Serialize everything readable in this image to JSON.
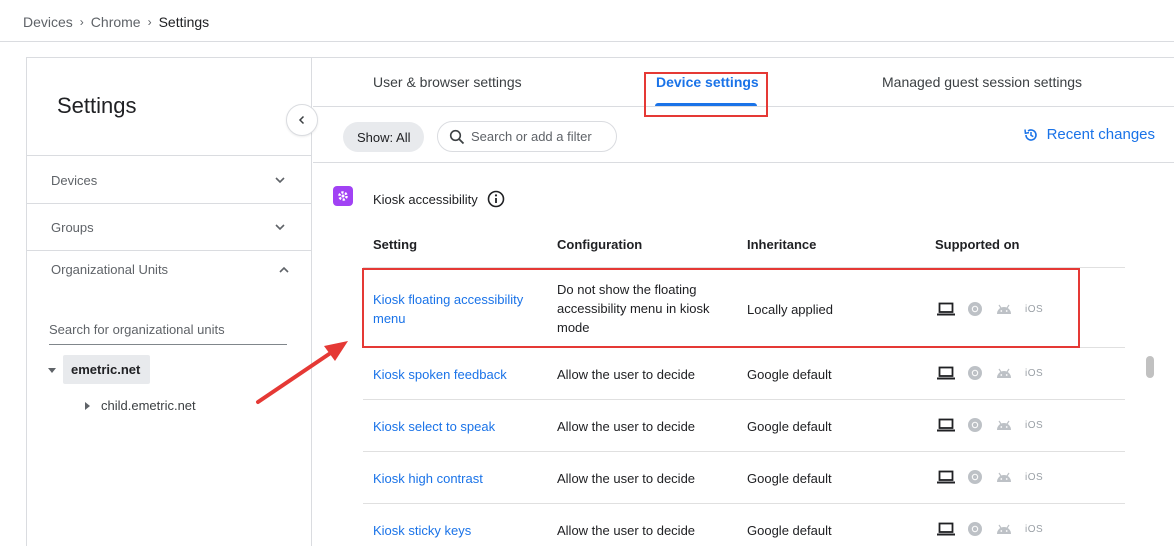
{
  "breadcrumb": {
    "items": [
      "Devices",
      "Chrome",
      "Settings"
    ]
  },
  "sidebar": {
    "title": "Settings",
    "items": [
      {
        "label": "Devices"
      },
      {
        "label": "Groups"
      }
    ],
    "ou": {
      "title": "Organizational Units",
      "search_placeholder": "Search for organizational units",
      "root": "emetric.net",
      "child": "child.emetric.net"
    }
  },
  "tabs": [
    {
      "label": "User & browser settings"
    },
    {
      "label": "Device settings"
    },
    {
      "label": "Managed guest session settings"
    }
  ],
  "filter": {
    "show_label": "Show: All",
    "search_placeholder": "Search or add a filter",
    "recent_changes": "Recent changes"
  },
  "section": {
    "title": "Kiosk accessibility"
  },
  "table": {
    "headers": [
      "Setting",
      "Configuration",
      "Inheritance",
      "Supported on"
    ],
    "rows": [
      {
        "setting": "Kiosk floating accessibility menu",
        "configuration": "Do not show the floating accessibility menu in kiosk mode",
        "inheritance": "Locally applied"
      },
      {
        "setting": "Kiosk spoken feedback",
        "configuration": "Allow the user to decide",
        "inheritance": "Google default"
      },
      {
        "setting": "Kiosk select to speak",
        "configuration": "Allow the user to decide",
        "inheritance": "Google default"
      },
      {
        "setting": "Kiosk high contrast",
        "configuration": "Allow the user to decide",
        "inheritance": "Google default"
      },
      {
        "setting": "Kiosk sticky keys",
        "configuration": "Allow the user to decide",
        "inheritance": "Google default"
      }
    ],
    "ios_label": "iOS"
  },
  "colors": {
    "accent": "#1a73e8",
    "annotation": "#e53935",
    "section_icon": "#a142f4"
  }
}
